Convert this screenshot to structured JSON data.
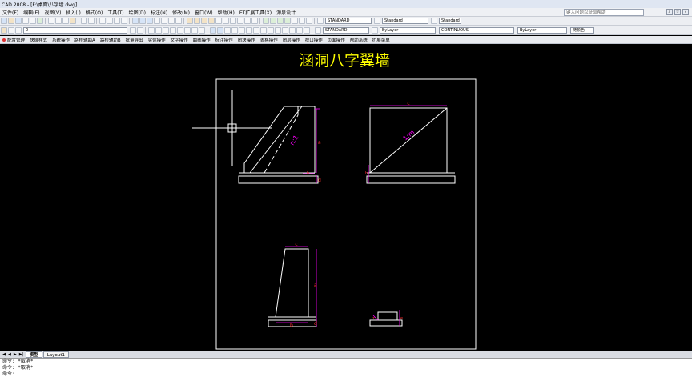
{
  "window": {
    "title": "CAD 2008 - [F:\\桌面\\八字墙.dwg]"
  },
  "menu": [
    "文件(F)",
    "编辑(E)",
    "视图(V)",
    "插入(I)",
    "格式(O)",
    "工具(T)",
    "绘图(D)",
    "标注(N)",
    "修改(M)",
    "窗口(W)",
    "帮助(H)",
    "ET扩展工具(X)",
    "源泉设计"
  ],
  "search": {
    "placeholder": "键入问题以获取帮助"
  },
  "toolbar1": {
    "textstyle": "STANDARD",
    "dimstyle": "Standard",
    "tablestyle": "Standard",
    "layer_name": "XG"
  },
  "toolbar2": {
    "layer_value": "0",
    "style": "STANDARD",
    "color": "ByLayer",
    "linetype": "CONTINUOUS",
    "lineweight": "ByLayer",
    "plotstyle": "随颜色"
  },
  "subtoolbar": [
    "配置管理",
    "快捷样式",
    "系统操作",
    "路桥辅助A",
    "路桥辅助B",
    "批量导出",
    "实体操作",
    "文字操作",
    "曲线操作",
    "标注操作",
    "图块操作",
    "表格操作",
    "图层操作",
    "视口操作",
    "页面操作",
    "帮助系统",
    "扩展菜单"
  ],
  "drawing": {
    "title": "涵洞八字翼墙",
    "slope_label_1": "n:1",
    "slope_label_2": "1:m",
    "dim_a": "a",
    "dim_b": "b",
    "dim_c": "c",
    "dim_d": "d",
    "dim_e": "e",
    "dim_h": "h",
    "dim_z": "z"
  },
  "tabs": [
    "模型",
    "Layout1"
  ],
  "command_lines": [
    "命令: *取消*",
    "命令: *取消*",
    "命令:"
  ],
  "colors": {
    "drawing": "#ffffff",
    "dimension": "#ff00ff",
    "title": "#ffff00",
    "dimtext": "#ff3030"
  }
}
